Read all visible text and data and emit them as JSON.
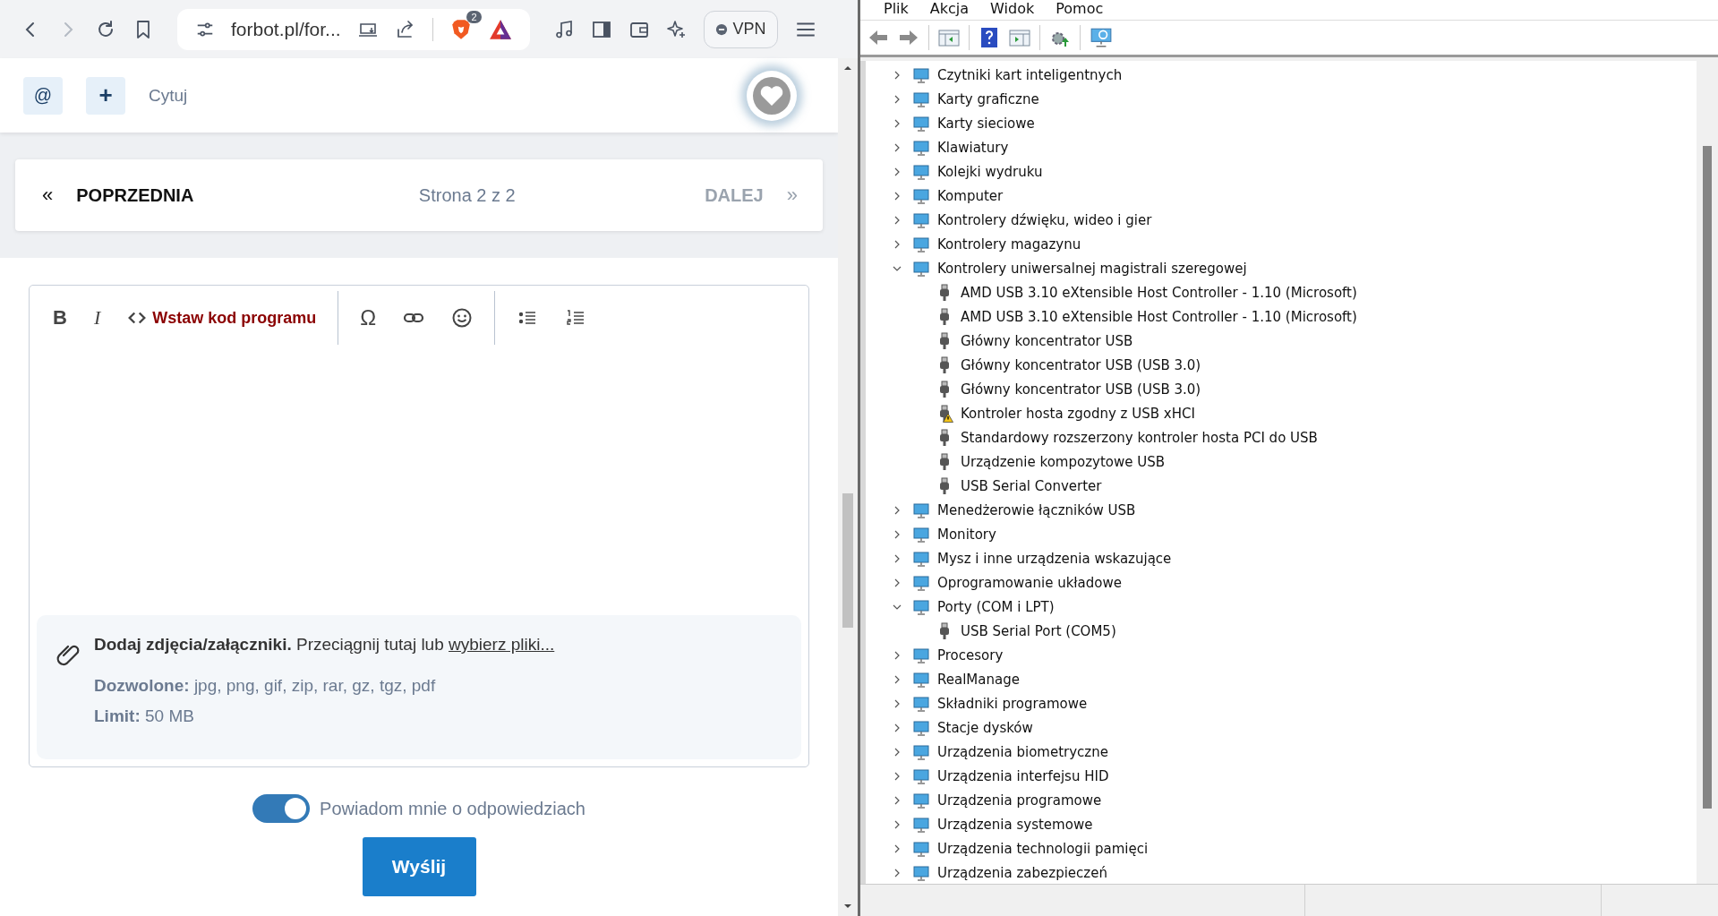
{
  "browser": {
    "back_disabled": false,
    "forward_disabled": true,
    "url": "forbot.pl/for...",
    "shields_count": "2",
    "vpn_label": "VPN"
  },
  "reply_bar": {
    "mention": "@",
    "add": "+",
    "quote": "Cytuj"
  },
  "pagination": {
    "prev_arrow": "«",
    "prev": "POPRZEDNIA",
    "page": "Strona 2 z 2",
    "next": "DALEJ",
    "next_arrow": "»",
    "next_disabled": true
  },
  "editor": {
    "toolbar": [
      {
        "kind": "bold",
        "label": "B"
      },
      {
        "kind": "italic",
        "label": "I"
      },
      {
        "kind": "code",
        "label": "Wstaw kod programu"
      },
      {
        "kind": "separator"
      },
      {
        "kind": "symbol",
        "label": "Ω"
      },
      {
        "kind": "link"
      },
      {
        "kind": "emoji"
      },
      {
        "kind": "separator"
      },
      {
        "kind": "bullets"
      },
      {
        "kind": "numbers"
      }
    ],
    "attachments": {
      "text": "**Dodaj zdjęcia/załączniki.** Przeciągnij tutaj lub",
      "link": "wybierz pliki...",
      "allowed": "**Dozwolone:** jpg, png, gif, zip, rar, gz, tgz, pdf",
      "limit": "**Limit:** 50 MB"
    }
  },
  "notify": {
    "label": "Powiadom mnie o odpowiedziach",
    "on": true
  },
  "submit": "Wyślij",
  "device_manager": {
    "menu": [
      "Plik",
      "Akcja",
      "Widok",
      "Pomoc"
    ],
    "tree": [
      {
        "label": "Czytniki kart inteligentnych",
        "expanded": false
      },
      {
        "label": "Karty graficzne",
        "expanded": false
      },
      {
        "label": "Karty sieciowe",
        "expanded": false
      },
      {
        "label": "Klawiatury",
        "expanded": false
      },
      {
        "label": "Kolejki wydruku",
        "expanded": false
      },
      {
        "label": "Komputer",
        "expanded": false
      },
      {
        "label": "Kontrolery dźwięku, wideo i gier",
        "expanded": false
      },
      {
        "label": "Kontrolery magazynu",
        "expanded": false
      },
      {
        "label": "Kontrolery uniwersalnej magistrali szeregowej",
        "expanded": true,
        "children": [
          {
            "label": "AMD USB 3.10 eXtensible Host Controller - 1.10 (Microsoft)",
            "warning": false
          },
          {
            "label": "AMD USB 3.10 eXtensible Host Controller - 1.10 (Microsoft)",
            "warning": false
          },
          {
            "label": "Główny koncentrator USB",
            "warning": false
          },
          {
            "label": "Główny koncentrator USB (USB 3.0)",
            "warning": false
          },
          {
            "label": "Główny koncentrator USB (USB 3.0)",
            "warning": false
          },
          {
            "label": "Kontroler hosta zgodny z USB xHCI",
            "warning": true
          },
          {
            "label": "Standardowy rozszerzony kontroler hosta PCI do USB",
            "warning": false
          },
          {
            "label": "Urządzenie kompozytowe USB",
            "warning": false
          },
          {
            "label": "USB Serial Converter",
            "warning": false
          }
        ]
      },
      {
        "label": "Menedżerowie łączników USB",
        "expanded": false
      },
      {
        "label": "Monitory",
        "expanded": false
      },
      {
        "label": "Mysz i inne urządzenia wskazujące",
        "expanded": false
      },
      {
        "label": "Oprogramowanie układowe",
        "expanded": false
      },
      {
        "label": "Porty (COM i LPT)",
        "expanded": true,
        "children": [
          {
            "label": "USB Serial Port (COM5)",
            "warning": false
          }
        ]
      },
      {
        "label": "Procesory",
        "expanded": false
      },
      {
        "label": "RealManage",
        "expanded": false
      },
      {
        "label": "Składniki programowe",
        "expanded": false
      },
      {
        "label": "Stacje dysków",
        "expanded": false
      },
      {
        "label": "Urządzenia biometryczne",
        "expanded": false
      },
      {
        "label": "Urządzenia interfejsu HID",
        "expanded": false
      },
      {
        "label": "Urządzenia programowe",
        "expanded": false
      },
      {
        "label": "Urządzenia systemowe",
        "expanded": false
      },
      {
        "label": "Urządzenia technologii pamięci",
        "expanded": false
      },
      {
        "label": "Urządzenia zabezpieczeń",
        "expanded": false
      }
    ]
  }
}
